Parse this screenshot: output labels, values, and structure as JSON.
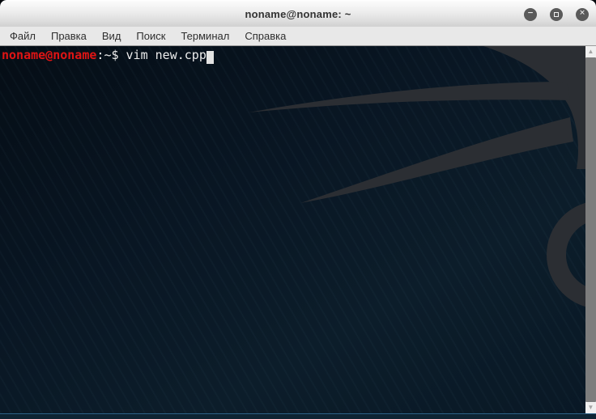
{
  "window": {
    "title": "noname@noname: ~",
    "controls": [
      {
        "name": "minimize",
        "glyph": "−"
      },
      {
        "name": "maximize",
        "glyph": "□"
      },
      {
        "name": "close",
        "glyph": "✕"
      }
    ]
  },
  "menu_bar": {
    "items": [
      "Файл",
      "Правка",
      "Вид",
      "Поиск",
      "Терминал",
      "Справка"
    ]
  },
  "terminal": {
    "prompt_user_host": "noname@noname",
    "prompt_separator": ":",
    "prompt_path": "~",
    "prompt_symbol": "$ ",
    "command": "vim new.cpp",
    "cursor_visible": true
  },
  "scrollbar": {
    "up_glyph": "▲",
    "down_glyph": "▼"
  },
  "colors": {
    "prompt_user_host": "#e01414",
    "terminal_text": "#ededed",
    "terminal_bg": "#0a1927",
    "dragon_watermark": "#2b2e33",
    "titlebar_text": "#333333",
    "bottom_border_line": "#2c6287",
    "control_button_bg": "#5a5a5a"
  }
}
